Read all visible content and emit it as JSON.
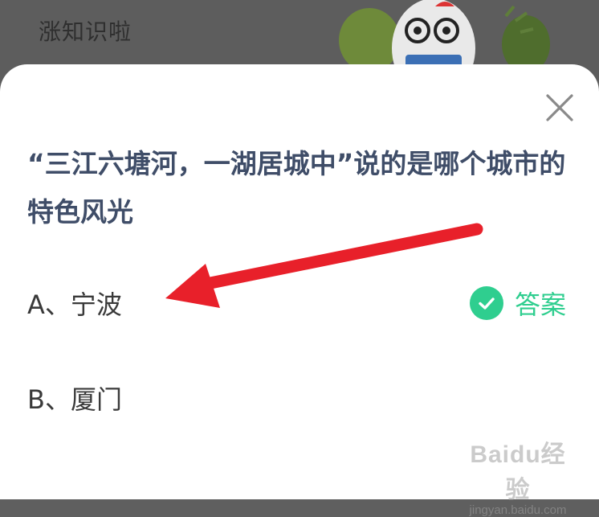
{
  "backdrop": {
    "title": "涨知识啦"
  },
  "question": {
    "text": "“三江六塘河，一湖居城中”说的是哪个城市的特色风光"
  },
  "options": [
    {
      "label": "A、宁波",
      "is_answer": true
    },
    {
      "label": "B、厦门",
      "is_answer": false
    }
  ],
  "answer_badge": {
    "label": "答案",
    "icon": "check-icon",
    "color": "#2fce8f"
  },
  "close": {
    "icon": "close-icon"
  },
  "annotation": {
    "icon": "red-arrow",
    "color": "#e8202a"
  },
  "watermark": {
    "logo": "Baidu经验",
    "url": "jingyan.baidu.com"
  }
}
